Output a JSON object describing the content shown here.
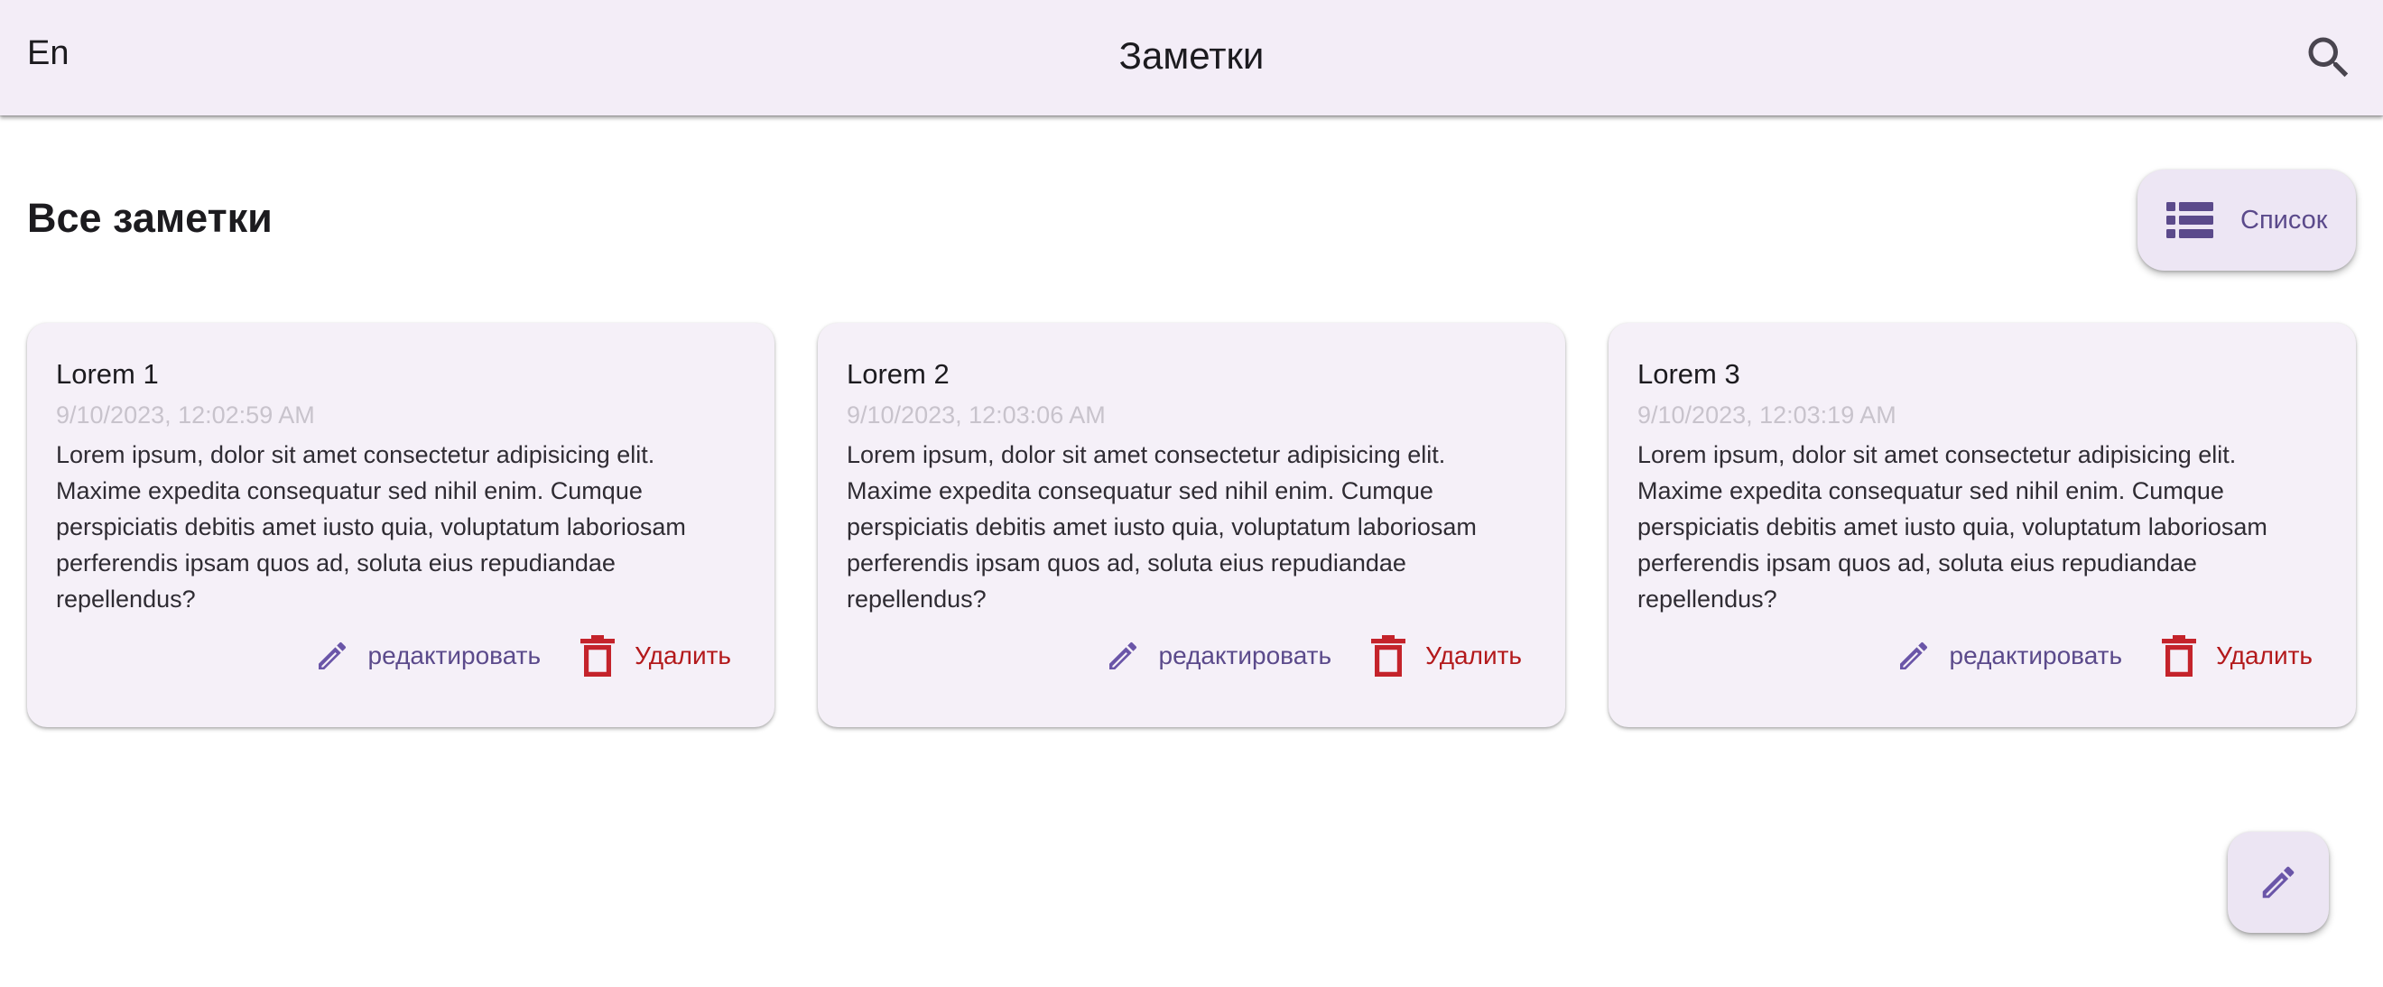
{
  "app": {
    "title": "Заметки",
    "language_toggle": "En",
    "search_icon": "search-icon"
  },
  "main": {
    "section_title": "Все заметки",
    "view_toggle_label": "Список",
    "view_toggle_icon": "list-icon"
  },
  "notes": [
    {
      "title": "Lorem 1",
      "date": "9/10/2023, 12:02:59 AM",
      "text": "Lorem ipsum, dolor sit amet consectetur adipisicing elit. Maxime expedita consequatur sed nihil enim. Cumque perspiciatis debitis amet iusto quia, voluptatum laboriosam perferendis ipsam quos ad, soluta eius repudiandae repellendus?",
      "edit_label": "редактировать",
      "delete_label": "Удалить"
    },
    {
      "title": "Lorem 2",
      "date": "9/10/2023, 12:03:06 AM",
      "text": "Lorem ipsum, dolor sit amet consectetur adipisicing elit. Maxime expedita consequatur sed nihil enim. Cumque perspiciatis debitis amet iusto quia, voluptatum laboriosam perferendis ipsam quos ad, soluta eius repudiandae repellendus?",
      "edit_label": "редактировать",
      "delete_label": "Удалить"
    },
    {
      "title": "Lorem 3",
      "date": "9/10/2023, 12:03:19 AM",
      "text": "Lorem ipsum, dolor sit amet consectetur adipisicing elit. Maxime expedita consequatur sed nihil enim. Cumque perspiciatis debitis amet iusto quia, voluptatum laboriosam perferendis ipsam quos ad, soluta eius repudiandae repellendus?",
      "edit_label": "редактировать",
      "delete_label": "Удалить"
    }
  ],
  "fab": {
    "icon": "pencil-icon"
  },
  "colors": {
    "appbar_bg": "#f3edf7",
    "accent": "#5b4a8b",
    "danger": "#b3191b",
    "card_bg": "#f5f0f8"
  }
}
